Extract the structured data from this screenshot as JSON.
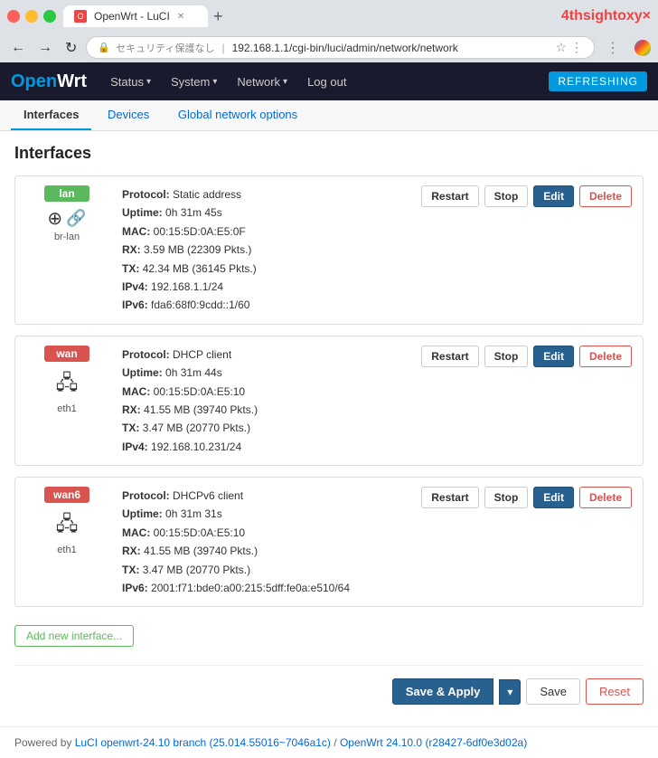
{
  "browser": {
    "tab_title": "OpenWrt - LuCI",
    "tab_favicon": "O",
    "address": "192.168.1.1/cgi-bin/luci/admin/network/network",
    "address_full": "🔒 セキュリティ保護なし | 192.168.1.1/cgi-bin/luci/admin/network/network",
    "watermark": "4thsight",
    "watermark_suffix": "oxy×"
  },
  "navbar": {
    "brand": "OpenWrt",
    "items": [
      {
        "label": "Status",
        "caret": true
      },
      {
        "label": "System",
        "caret": true
      },
      {
        "label": "Network",
        "caret": true
      },
      {
        "label": "Log out",
        "caret": false
      }
    ],
    "refreshing": "REFRESHING"
  },
  "tabs": [
    {
      "label": "Interfaces",
      "active": true
    },
    {
      "label": "Devices",
      "active": false
    },
    {
      "label": "Global network options",
      "active": false
    }
  ],
  "page_title": "Interfaces",
  "interfaces": [
    {
      "name": "lan",
      "badge_color": "green",
      "icon1": "⊕",
      "icon2": "🔗",
      "sub_label": "br-lan",
      "protocol": "Static address",
      "uptime": "0h 31m 45s",
      "mac": "00:15:5D:0A:E5:0F",
      "rx": "3.59 MB (22309 Pkts.)",
      "tx": "42.34 MB (36145 Pkts.)",
      "ipv4": "192.168.1.1/24",
      "ipv6": "fda6:68f0:9cdd::1/60",
      "has_ipv6": true
    },
    {
      "name": "wan",
      "badge_color": "red",
      "icon1": "🖧",
      "icon2": null,
      "sub_label": "eth1",
      "protocol": "DHCP client",
      "uptime": "0h 31m 44s",
      "mac": "00:15:5D:0A:E5:10",
      "rx": "41.55 MB (39740 Pkts.)",
      "tx": "3.47 MB (20770 Pkts.)",
      "ipv4": "192.168.10.231/24",
      "ipv6": null,
      "has_ipv6": false
    },
    {
      "name": "wan6",
      "badge_color": "red",
      "icon1": "🖧",
      "icon2": null,
      "sub_label": "eth1",
      "protocol": "DHCPv6 client",
      "uptime": "0h 31m 31s",
      "mac": "00:15:5D:0A:E5:10",
      "rx": "41.55 MB (39740 Pkts.)",
      "tx": "3.47 MB (20770 Pkts.)",
      "ipv4": null,
      "ipv6": "2001:f71:bde0:a00:215:5dff:fe0a:e510/64",
      "has_ipv6": true
    }
  ],
  "buttons": {
    "restart": "Restart",
    "stop": "Stop",
    "edit": "Edit",
    "delete": "Delete",
    "add_interface": "Add new interface...",
    "save_apply": "Save & Apply",
    "save": "Save",
    "reset": "Reset"
  },
  "footer": {
    "text": "Powered by ",
    "luci_link": "LuCI openwrt-24.10 branch (25.014.55016~7046a1c)",
    "separator": " / ",
    "owrt_link": "OpenWrt 24.10.0 (r28427-6df0e3d02a)"
  }
}
